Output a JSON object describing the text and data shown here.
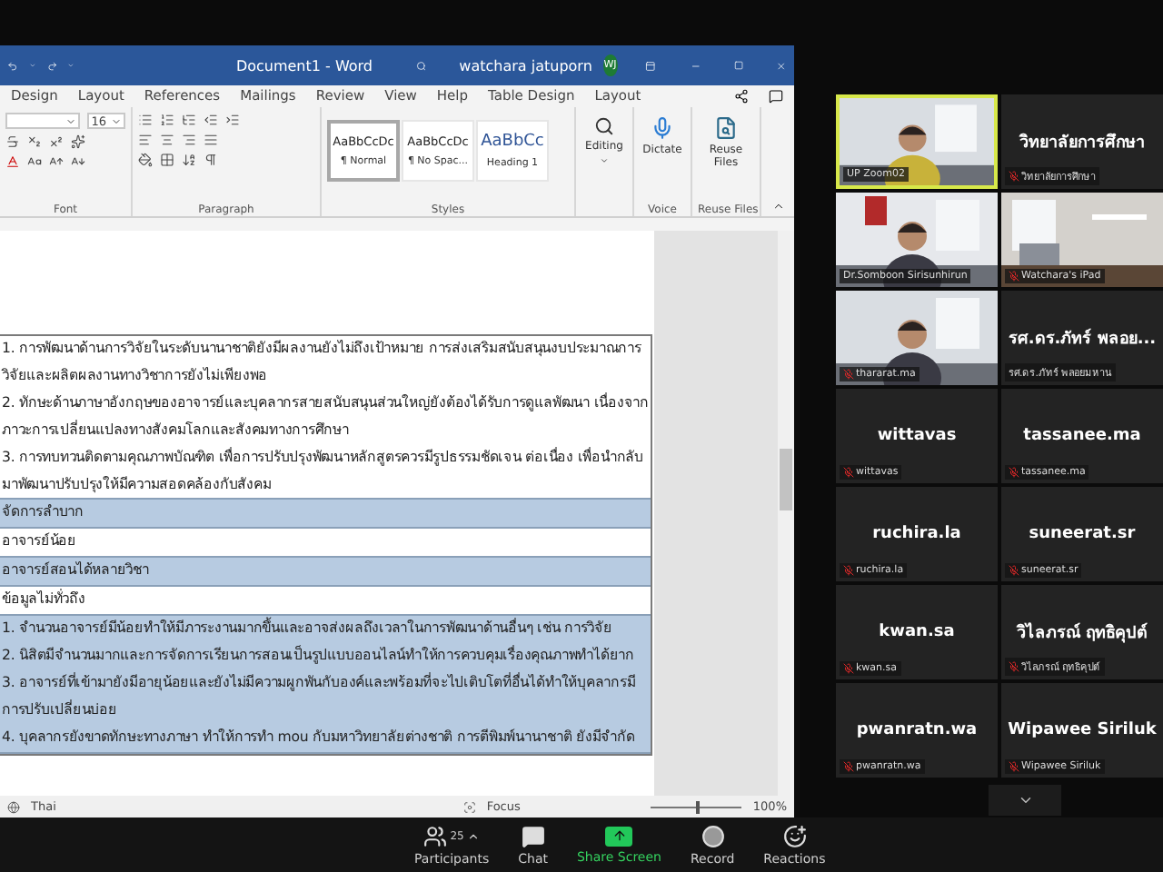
{
  "word": {
    "title": "Document1 - Word",
    "user": "watchara jatuporn",
    "initials": "WJ",
    "tabs": [
      {
        "label": "Design",
        "selected": false
      },
      {
        "label": "Layout",
        "selected": false
      },
      {
        "label": "References",
        "selected": false
      },
      {
        "label": "Mailings",
        "selected": false
      },
      {
        "label": "Review",
        "selected": false
      },
      {
        "label": "View",
        "selected": false
      },
      {
        "label": "Help",
        "selected": false
      },
      {
        "label": "Table Design",
        "selected": false
      },
      {
        "label": "Layout",
        "selected": false
      }
    ],
    "font_size": "16",
    "styles": [
      {
        "sample": "AaBbCcDc",
        "name": "¶ Normal",
        "selected": true,
        "kind": "body"
      },
      {
        "sample": "AaBbCcDc",
        "name": "¶ No Spac...",
        "selected": false,
        "kind": "body"
      },
      {
        "sample": "AaBbCc",
        "name": "Heading 1",
        "selected": false,
        "kind": "heading"
      }
    ],
    "groups": {
      "font": "Font",
      "paragraph": "Paragraph",
      "styles": "Styles",
      "voice": "Voice",
      "reuse": "Reuse Files"
    },
    "editing": "Editing",
    "dictate": "Dictate",
    "reuse_button": "Reuse Files",
    "document": {
      "rows": [
        {
          "shaded": false,
          "paragraphs": [
            "1. การพัฒนาด้านการวิจัยในระดับนานาชาติยังมีผลงานยังไม่ถึงเป้าหมาย การส่งเสริมสนับสนุนงบประมาณการวิจัยและผลิตผลงานทางวิชาการยังไม่เพียงพอ",
            "2. ทักษะด้านภาษาอังกฤษของอาจารย์และบุคลากรสายสนับสนุนส่วนใหญ่ยังต้องได้รับการดูแลพัฒนา เนื่องจากภาวะการเปลี่ยนแปลงทางสังคมโลกและสังคมทางการศึกษา",
            "3. การทบทวนติดตามคุณภาพบัณฑิต เพื่อการปรับปรุงพัฒนาหลักสูตรควรมีรูปธรรมชัดเจน ต่อเนื่อง เพื่อนำกลับมาพัฒนาปรับปรุงให้มีความสอดคล้องกับสังคม"
          ]
        },
        {
          "shaded": true,
          "paragraphs": [
            "จัดการลำบาก"
          ]
        },
        {
          "shaded": false,
          "paragraphs": [
            "อาจารย์น้อย"
          ]
        },
        {
          "shaded": true,
          "paragraphs": [
            "อาจารย์สอนได้หลายวิชา"
          ]
        },
        {
          "shaded": false,
          "paragraphs": [
            "ข้อมูลไม่ทั่วถึง"
          ]
        },
        {
          "shaded": true,
          "paragraphs": [
            "1. จำนวนอาจารย์มีน้อยทำให้มีภาระงานมากขึ้นและอาจส่งผลถึงเวลาในการพัฒนาด้านอื่นๆ เช่น การวิจัย",
            "2. นิสิตมีจำนวนมากและการจัดการเรียนการสอนเป็นรูปแบบออนไลน์ทำให้การควบคุมเรื่องคุณภาพทำได้ยาก",
            "3. อาจารย์ที่เข้ามายังมีอายุน้อยและยังไม่มีความผูกพันกับองค์และพร้อมที่จะไปเติบโตที่อื่นได้ทำให้บุคลากรมีการปรับเปลี่ยนบ่อย",
            "4. บุคลากรยังขาดทักษะทางภาษา ทำให้การทำ mou กับมหาวิทยาลัยต่างชาติ การตีพิมพ์นานาชาติ ยังมีจำกัด"
          ]
        }
      ]
    },
    "status": {
      "language": "Thai",
      "focus": "Focus",
      "zoom": "100%",
      "zoom_slider": {
        "level": 0.5
      }
    }
  },
  "gallery": [
    {
      "kind": "video",
      "label": "UP Zoom02",
      "muted": false,
      "speaking": true
    },
    {
      "kind": "name",
      "name": "วิทยาลัยการศึกษา",
      "label": "วิทยาลัยการศึกษา",
      "muted": true,
      "speaking": false
    },
    {
      "kind": "video",
      "label": "Dr.Somboon Sirisunhirun",
      "muted": false,
      "speaking": false
    },
    {
      "kind": "video",
      "label": "Watchara's iPad",
      "muted": true,
      "speaking": false
    },
    {
      "kind": "video",
      "label": "thararat.ma",
      "muted": true,
      "speaking": false
    },
    {
      "kind": "name",
      "name": "รศ.ดร.ภัทร์ พลอย...",
      "label": "รศ.ดร.ภัทร์ พลอยมหาน",
      "muted": false,
      "speaking": false
    },
    {
      "kind": "name",
      "name": "wittavas",
      "label": "wittavas",
      "muted": true,
      "speaking": false
    },
    {
      "kind": "name",
      "name": "tassanee.ma",
      "label": "tassanee.ma",
      "muted": true,
      "speaking": false
    },
    {
      "kind": "name",
      "name": "ruchira.la",
      "label": "ruchira.la",
      "muted": true,
      "speaking": false
    },
    {
      "kind": "name",
      "name": "suneerat.sr",
      "label": "suneerat.sr",
      "muted": true,
      "speaking": false
    },
    {
      "kind": "name",
      "name": "kwan.sa",
      "label": "kwan.sa",
      "muted": true,
      "speaking": false
    },
    {
      "kind": "name",
      "name": "วิไลภรณ์ ฤทธิคุปต์",
      "label": "วิไลภรณ์ ฤทธิคุปต์",
      "muted": true,
      "speaking": false
    },
    {
      "kind": "name",
      "name": "pwanratn.wa",
      "label": "pwanratn.wa",
      "muted": true,
      "speaking": false
    },
    {
      "kind": "name",
      "name": "Wipawee Siriluk",
      "label": "Wipawee Siriluk",
      "muted": true,
      "speaking": false
    }
  ],
  "toolbar": [
    {
      "kind": "participants",
      "label": "Participants",
      "count": "25"
    },
    {
      "kind": "chat",
      "label": "Chat"
    },
    {
      "kind": "share",
      "label": "Share Screen"
    },
    {
      "kind": "record",
      "label": "Record"
    },
    {
      "kind": "reactions",
      "label": "Reactions"
    }
  ]
}
